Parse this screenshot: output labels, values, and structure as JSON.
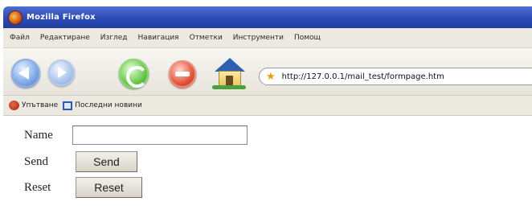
{
  "window": {
    "title": "Mozilla Firefox"
  },
  "menu": {
    "items": [
      "Файл",
      "Редактиране",
      "Изглед",
      "Навигация",
      "Отметки",
      "Инструменти",
      "Помощ"
    ]
  },
  "navbar": {
    "url": "http://127.0.0.1/mail_test/formpage.htm",
    "buttons": {
      "back": "back-arrow-icon",
      "forward": "forward-arrow-icon",
      "reload": "reload-icon",
      "stop": "stop-icon",
      "home": "home-icon"
    }
  },
  "bookmarks": {
    "items": [
      {
        "label": "Упътване",
        "icon": "help-icon"
      },
      {
        "label": "Последни новини",
        "icon": "rss-feed-icon"
      }
    ]
  },
  "form": {
    "name_label": "Name",
    "name_value": "",
    "send_label": "Send",
    "send_button": "Send",
    "reset_label": "Reset",
    "reset_button": "Reset"
  }
}
